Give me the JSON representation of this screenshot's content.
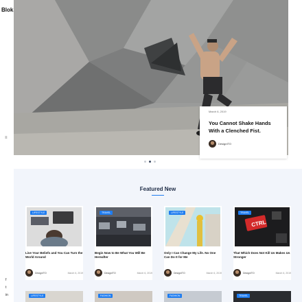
{
  "brand": {
    "logo": "Blok."
  },
  "hero": {
    "date": "March 6, 2019",
    "title": "You Cannot Shake Hands With a Clenched Fist.",
    "author": "DesignITO"
  },
  "slider": {
    "count": 3,
    "active": 1
  },
  "featured": {
    "heading": "Featured New",
    "cards": [
      {
        "tag": "LIFESTYLE",
        "title": "Live Your Beliefs and You Can Turn the World Around",
        "author": "DesignITO",
        "date": "March 6, 2019"
      },
      {
        "tag": "TRAVEL",
        "title": "Begin Now to Be What You Will Be Hereafter",
        "author": "DesignITO",
        "date": "March 6, 2019"
      },
      {
        "tag": "LIFESTYLE",
        "title": "Only I Can Change My Life. No One Can Do It for Me",
        "author": "DesignITO",
        "date": "March 6, 2019"
      },
      {
        "tag": "TRAVEL",
        "title": "That Which Does Not Kill Us Makes Us Stronger",
        "author": "DesignITO",
        "date": "March 6, 2019"
      }
    ],
    "next_row_tags": [
      "LIFESTYLE",
      "FASHION",
      "FASHION",
      "TRAVEL"
    ]
  },
  "social": {
    "icons": [
      "facebook-icon",
      "twitter-icon",
      "linkedin-icon"
    ],
    "glyphs": [
      "f",
      "t",
      "in"
    ]
  },
  "colors": {
    "accent": "#1e7cf0",
    "section_bg": "#f2f5fb"
  }
}
